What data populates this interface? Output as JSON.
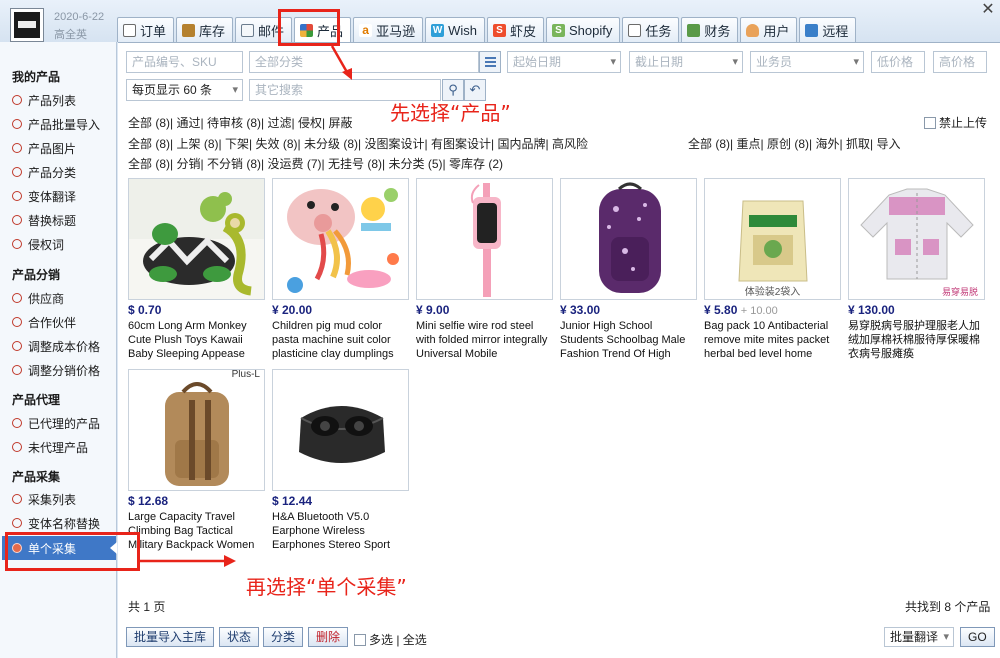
{
  "user": {
    "date": "2020-6-22",
    "name": "高全英"
  },
  "tabs": [
    {
      "label": "订单",
      "icon": "document-icon"
    },
    {
      "label": "库存",
      "icon": "box-icon"
    },
    {
      "label": "邮件",
      "icon": "mail-icon"
    },
    {
      "label": "产品",
      "icon": "grid-icon",
      "active": true
    },
    {
      "label": "亚马逊",
      "icon": "amazon-icon"
    },
    {
      "label": "Wish",
      "icon": "wish-icon"
    },
    {
      "label": "虾皮",
      "icon": "shopee-icon"
    },
    {
      "label": "Shopify",
      "icon": "shopify-icon"
    },
    {
      "label": "任务",
      "icon": "task-icon"
    },
    {
      "label": "财务",
      "icon": "finance-icon"
    },
    {
      "label": "用户",
      "icon": "user-icon"
    },
    {
      "label": "远程",
      "icon": "remote-icon"
    }
  ],
  "sidebar": {
    "sections": [
      {
        "title": "我的产品",
        "items": [
          "产品列表",
          "产品批量导入",
          "产品图片",
          "产品分类",
          "变体翻译",
          "替换标题",
          "侵权词"
        ]
      },
      {
        "title": "产品分销",
        "items": [
          "供应商",
          "合作伙伴",
          "调整成本价格",
          "调整分销价格"
        ]
      },
      {
        "title": "产品代理",
        "items": [
          "已代理的产品",
          "未代理产品"
        ]
      },
      {
        "title": "产品采集",
        "items": [
          "采集列表",
          "变体名称替换",
          "单个采集"
        ]
      }
    ],
    "selected": "单个采集"
  },
  "search": {
    "sku_placeholder": "产品编号、SKU",
    "category_placeholder": "全部分类",
    "start_date": "起始日期",
    "end_date": "截止日期",
    "salesman": "业务员",
    "low_price": "低价格",
    "high_price": "高价格",
    "page_size": "每页显示 60 条",
    "other_placeholder": "其它搜索"
  },
  "filters": {
    "row1": [
      "全部",
      "(8)",
      "通过",
      "待审核",
      "(8)",
      "过滤",
      "侵权",
      "屏蔽"
    ],
    "disable_upload": "禁止上传",
    "row2a": [
      "全部",
      "(8)",
      "上架",
      "(8)",
      "下架",
      "失效",
      "(8)",
      "未分级",
      "(8)",
      "没图案设计",
      "有图案设计",
      "国内品牌",
      "高风险"
    ],
    "row2b": [
      "全部",
      "(8)",
      "重点",
      "原创",
      "(8)",
      "海外",
      "抓取",
      "导入"
    ],
    "row3": [
      "全部",
      "(8)",
      "分销",
      "不分销",
      "(8)",
      "没运费",
      "(7)",
      "无挂号",
      "(8)",
      "未分类",
      "(5)",
      "零库存",
      "(2)"
    ]
  },
  "products": [
    {
      "price": "$ 0.70",
      "title": "60cm Long Arm Monkey Cute Plush Toys Kawaii Baby Sleeping Appease"
    },
    {
      "price": "¥ 20.00",
      "title": "Children pig mud color pasta machine suit color plasticine clay dumplings"
    },
    {
      "price": "¥ 9.00",
      "title": "Mini selfie wire rod steel with folded mirror integrally Universal Mobile"
    },
    {
      "price": "¥ 33.00",
      "title": "Junior High School Students Schoolbag Male Fashion Trend Of High"
    },
    {
      "price": "¥ 5.80",
      "orig": "+ 10.00",
      "title": "Bag pack 10 Antibacterial remove mite mites packet herbal bed level home"
    },
    {
      "price": "¥ 130.00",
      "title": "易穿脱病号服护理服老人加绒加厚棉袄棉服待厚保暖棉衣病号服瘫痪"
    },
    {
      "price": "$ 12.68",
      "title": "Large Capacity Travel Climbing Bag Tactical Military Backpack Women"
    },
    {
      "price": "$ 12.44",
      "title": "H&A Bluetooth V5.0 Earphone Wireless Earphones Stereo Sport"
    }
  ],
  "image_labels": {
    "p5": "体验装2袋入",
    "p6": "易穿易脱",
    "p7": "Plus-L"
  },
  "footer": {
    "pages": "共 1 页",
    "found": "共找到 8 个产品",
    "buttons": [
      "批量导入主库",
      "状态",
      "分类",
      "删除"
    ],
    "multi_select": "多选",
    "select_all": "| 全选",
    "batch_translate": "批量翻译",
    "go": "GO"
  },
  "annotations": {
    "step1": "先选择“产品”",
    "step2": "再选择“单个采集”"
  },
  "colors": {
    "accent": "#3f78c7",
    "annotation": "#e8241a",
    "filter_red": "#d7261b",
    "filter_green": "#1f9a2a"
  }
}
